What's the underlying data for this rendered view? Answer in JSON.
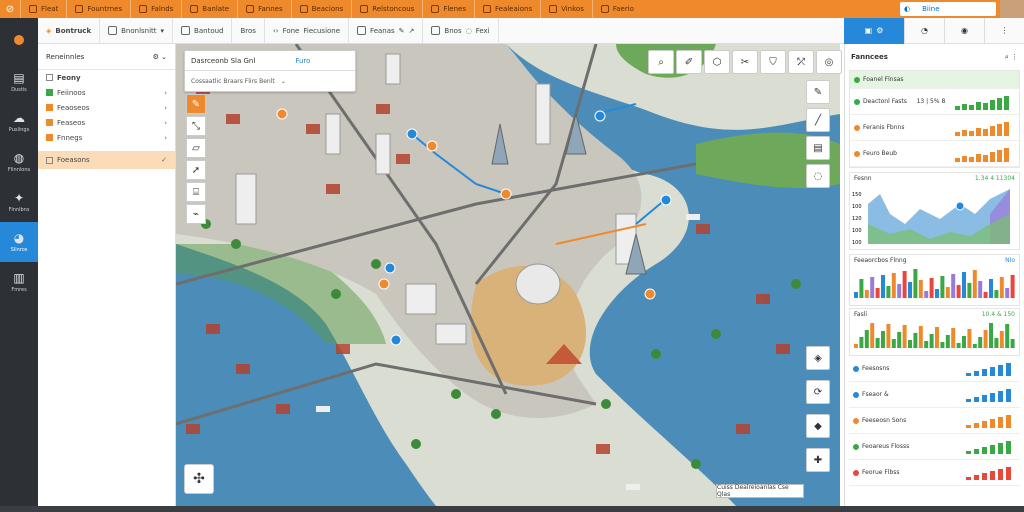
{
  "app": {
    "title": "Bontruck",
    "avatar": "avatar"
  },
  "menus": [
    "Fleat",
    "Fountrnes",
    "Falnds",
    "Banlate",
    "Fannes",
    "Beacions",
    "Relstoncous",
    "Flenes",
    "Fealeaions",
    "Vinkos",
    "Faerio"
  ],
  "toolbar": {
    "items": [
      "Bantoud",
      "Bros",
      "Fone",
      "Fiecusione",
      "Feanas",
      "Bnos",
      "Fexi",
      "Biine"
    ],
    "brand": "Bnonlsnitt"
  },
  "left_nav": [
    {
      "label": "Dustis",
      "icon": "layers-icon"
    },
    {
      "label": "Puslings",
      "icon": "cloud-icon"
    },
    {
      "label": "Flinnlons",
      "icon": "globe-icon"
    },
    {
      "label": "Flnnlbns",
      "icon": "star-icon"
    },
    {
      "label": "Sllnros",
      "icon": "pie-icon"
    },
    {
      "label": "Fmres",
      "icon": "doc-icon"
    }
  ],
  "layers": {
    "title": "Reneinnles",
    "section": "Feony",
    "items": [
      "Feiinoos",
      "Feaoseos",
      "Feaseos",
      "Fnnegs"
    ],
    "selected": "Foeasons"
  },
  "search": {
    "title": "Dasrceonb Sla Gnl",
    "tag": "Furo",
    "subtitle": "Cossaatlic Braars Flirs Benlt"
  },
  "scale": "Cuiss Dealreioanlas Cse Qlas",
  "stats": {
    "title": "Fanncees",
    "items": [
      {
        "label": "Foanel Flnsas",
        "value": "",
        "color": "#39a845"
      },
      {
        "label": "Deactonl Fasts",
        "value": "13 | 5% 8",
        "color": "#39a845"
      },
      {
        "label": "Feranis Fbnns",
        "value": "",
        "color": "#ef8a2c"
      },
      {
        "label": "Feuro Beub",
        "value": "",
        "color": "#ef8a2c"
      }
    ],
    "chart1": {
      "title": "Fesnn",
      "value": "1.34 4 11304",
      "ylabels": [
        "150",
        "100",
        "120",
        "100",
        "100"
      ]
    },
    "chart2": {
      "title": "Feeaorcbos Flnng",
      "value": "Nlo"
    },
    "chart3": {
      "title": "Fasli",
      "value": "10.4 & 150"
    },
    "bottom": [
      {
        "label": "Feesosns",
        "color": "#2688d8"
      },
      {
        "label": "Fseaor &",
        "color": "#2688d8"
      },
      {
        "label": "Feeseosn Sons",
        "color": "#ef8a2c"
      },
      {
        "label": "Feoareus Flosss",
        "color": "#39a845"
      },
      {
        "label": "Feorue Flbss",
        "color": "#e8473a"
      }
    ]
  },
  "colors": {
    "accent": "#ef8a2c",
    "blue": "#2688d8",
    "green": "#39a845",
    "water": "#4b8db8",
    "land": "#dfe4dc"
  }
}
